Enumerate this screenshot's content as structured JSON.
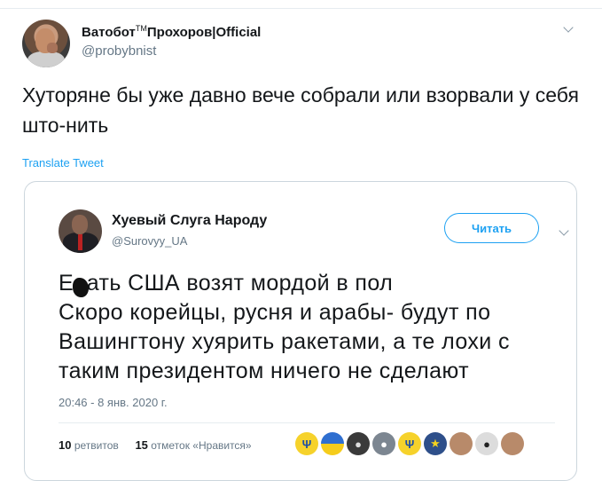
{
  "tweet": {
    "author_name": "Ватобот",
    "author_tm": "TM",
    "author_name_suffix": "Прохоров|Official",
    "author_handle": "@probybnist",
    "text": "Хуторяне бы уже давно вече собрали или взорвали у себя што-нить",
    "translate_label": "Translate Tweet"
  },
  "quoted": {
    "author_name": "Хуевый Слуга Народу",
    "author_handle": "@Surovyy_UA",
    "follow_label": "Читать",
    "text_lines": [
      "Е  ать США возят мордой в пол",
      "Скоро корейцы, русня и арабы- будут по",
      "Вашингтону хуярить ракетами, а те лохи с",
      "таким президентом ничего не сделают"
    ],
    "timestamp": "20:46 - 8 янв. 2020 г.",
    "retweet_count": "10",
    "retweet_label": "ретвитов",
    "like_count": "15",
    "like_label": "отметок «Нравится»",
    "liker_avatars": [
      "flag-ua",
      "flag-ua",
      "dark",
      "gray",
      "trident",
      "blue",
      "skin",
      "bw",
      "skin"
    ]
  },
  "colors": {
    "link": "#1da1f2",
    "secondary_text": "#657786",
    "border": "#ccd6dd"
  }
}
